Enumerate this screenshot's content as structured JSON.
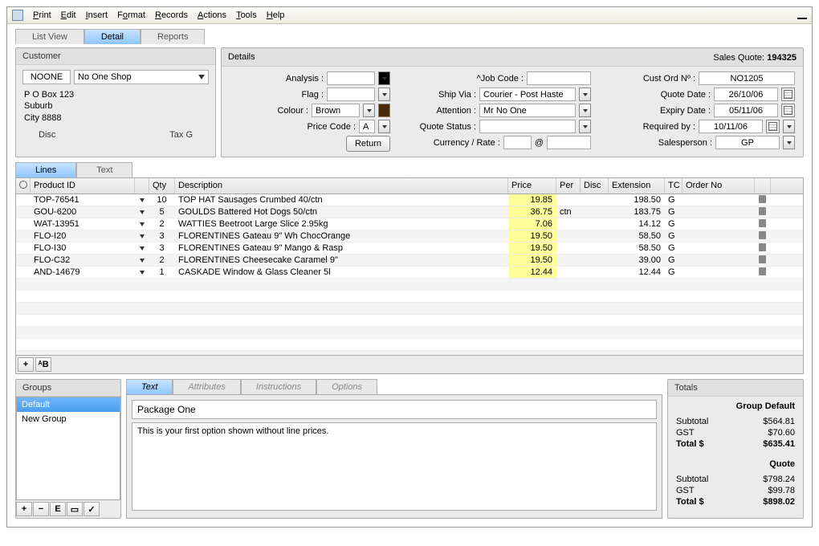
{
  "menu": [
    "Print",
    "Edit",
    "Insert",
    "Format",
    "Records",
    "Actions",
    "Tools",
    "Help"
  ],
  "tabs": {
    "list": "List View",
    "detail": "Detail",
    "reports": "Reports"
  },
  "customer": {
    "title": "Customer",
    "code": "NOONE",
    "name": "No One Shop",
    "addr1": "P O Box 123",
    "addr2": "Suburb",
    "addr3": "City  8888",
    "disc": "Disc",
    "tax": "Tax  G"
  },
  "details": {
    "title": "Details",
    "quote_label": "Sales Quote:",
    "quote_no": "194325",
    "labels": {
      "analysis": "Analysis :",
      "flag": "Flag :",
      "colour": "Colour :",
      "pricecode": "Price Code :",
      "jobcode": "^Job Code :",
      "shipvia": "Ship Via :",
      "attention": "Attention :",
      "quotestatus": "Quote Status :",
      "currency": "Currency / Rate :",
      "custord": "Cust Ord Nº :",
      "quotedate": "Quote Date :",
      "expiry": "Expiry Date :",
      "required": "Required by :",
      "salesperson": "Salesperson :"
    },
    "values": {
      "colour": "Brown",
      "pricecode": "A",
      "shipvia": "Courier - Post Haste",
      "attention": "Mr No One",
      "custord": "NO1205",
      "quotedate": "26/10/06",
      "expiry": "05/11/06",
      "required": "10/11/06",
      "salesperson": "GP",
      "at": "@"
    },
    "return_btn": "Return"
  },
  "lines": {
    "tab_lines": "Lines",
    "tab_text": "Text",
    "headers": {
      "gear": "",
      "id": "Product ID",
      "qty": "Qty",
      "desc": "Description",
      "price": "Price",
      "per": "Per",
      "disc": "Disc",
      "ext": "Extension",
      "tc": "TC",
      "order": "Order No"
    },
    "rows": [
      {
        "id": "TOP-76541",
        "qty": "10",
        "desc": "TOP HAT Sausages Crumbed 40/ctn",
        "price": "19.85",
        "per": "",
        "disc": "",
        "ext": "198.50",
        "tc": "G"
      },
      {
        "id": "GOU-6200",
        "qty": "5",
        "desc": "GOULDS Battered Hot Dogs 50/ctn",
        "price": "36.75",
        "per": "ctn",
        "disc": "",
        "ext": "183.75",
        "tc": "G"
      },
      {
        "id": "WAT-13951",
        "qty": "2",
        "desc": "WATTIES Beetroot Large Slice 2.95kg",
        "price": "7.06",
        "per": "",
        "disc": "",
        "ext": "14.12",
        "tc": "G"
      },
      {
        "id": "FLO-I20",
        "qty": "3",
        "desc": "FLORENTINES Gateau 9\" Wh ChocOrange",
        "price": "19.50",
        "per": "",
        "disc": "",
        "ext": "58.50",
        "tc": "G"
      },
      {
        "id": "FLO-I30",
        "qty": "3",
        "desc": "FLORENTINES Gateau 9\" Mango & Rasp",
        "price": "19.50",
        "per": "",
        "disc": "",
        "ext": "58.50",
        "tc": "G"
      },
      {
        "id": "FLO-C32",
        "qty": "2",
        "desc": "FLORENTINES Cheesecake Caramel 9\"",
        "price": "19.50",
        "per": "",
        "disc": "",
        "ext": "39.00",
        "tc": "G"
      },
      {
        "id": "AND-14679",
        "qty": "1",
        "desc": "CASKADE Window & Glass Cleaner 5l",
        "price": "12.44",
        "per": "",
        "disc": "",
        "ext": "12.44",
        "tc": "G"
      }
    ]
  },
  "groups": {
    "title": "Groups",
    "items": [
      "Default",
      "New Group"
    ]
  },
  "textpanel": {
    "tabs": {
      "text": "Text",
      "attributes": "Attributes",
      "instructions": "Instructions",
      "options": "Options"
    },
    "pkg_title": "Package One",
    "pkg_body": "This is your first option shown without line prices."
  },
  "totals": {
    "title": "Totals",
    "group_heading": "Group Default",
    "quote_heading": "Quote",
    "labels": {
      "subtotal": "Subtotal",
      "gst": "GST",
      "total": "Total  $"
    },
    "group": {
      "subtotal": "$564.81",
      "gst": "$70.60",
      "total": "$635.41"
    },
    "quote": {
      "subtotal": "$798.24",
      "gst": "$99.78",
      "total": "$898.02"
    }
  },
  "buttons": {
    "plus": "+",
    "minus": "−",
    "ab": "ᴬB",
    "e": "E",
    "box": "▭",
    "check": "✓"
  }
}
